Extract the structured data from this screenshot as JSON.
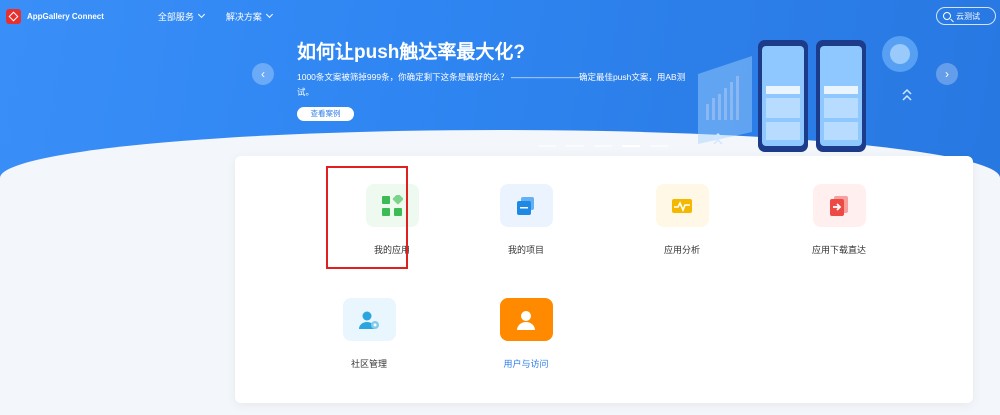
{
  "header": {
    "logo_text": "AppGallery Connect",
    "nav": [
      {
        "label": "全部服务"
      },
      {
        "label": "解决方案"
      }
    ],
    "search_placeholder": "云测试"
  },
  "banner": {
    "title": "如何让push触达率最大化?",
    "description": "1000条文案被筛掉999条，你确定剩下这条是最好的么？ ————————确定最佳push文案，用AB测试。",
    "button_label": "查看案例",
    "slide_count": 5,
    "active_slide": 4
  },
  "tiles": [
    {
      "label": "我的应用",
      "icon": "grid-icon",
      "bg": "#eefaf0",
      "color": "#3dbb54",
      "selected": true
    },
    {
      "label": "我的项目",
      "icon": "stack-icon",
      "bg": "#ebf4fe",
      "color": "#1e88e5",
      "selected": false
    },
    {
      "label": "应用分析",
      "icon": "pulse-icon",
      "bg": "#fff8e6",
      "color": "#f5b800",
      "selected": false
    },
    {
      "label": "应用下载直达",
      "icon": "download-direct-icon",
      "bg": "#fff0ef",
      "color": "#ee4a45",
      "selected": false
    },
    {
      "label": "社区管理",
      "icon": "community-user-icon",
      "bg": "#eaf6fd",
      "color": "#2aa5e0",
      "selected": false
    },
    {
      "label": "用户与访问",
      "icon": "user-icon",
      "bg": "#ff8a00",
      "color": "#ffffff",
      "selected": false,
      "highlighted": true
    }
  ],
  "colors": {
    "banner": "#2f86f2",
    "selection_border": "#e02020",
    "highlight_text": "#2d7cea"
  }
}
